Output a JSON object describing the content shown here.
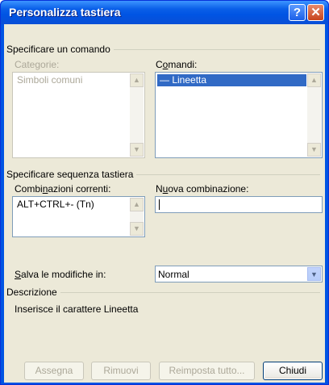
{
  "window": {
    "title": "Personalizza tastiera",
    "help_symbol": "?",
    "close_symbol": "✕"
  },
  "specify_command": {
    "group_label": "Specificare un comando",
    "categories_label": "Categorie:",
    "categories_items": [
      "Simboli comuni"
    ],
    "commands_label_pre": "C",
    "commands_label_ul": "o",
    "commands_label_post": "mandi:",
    "commands_items": [
      "— Lineetta"
    ]
  },
  "keyboard_sequence": {
    "group_label": "Specificare sequenza tastiera",
    "current_label_pre": "Combi",
    "current_label_ul": "n",
    "current_label_post": "azioni correnti:",
    "current_items": [
      "ALT+CTRL+- (Tn)"
    ],
    "new_label_pre": "N",
    "new_label_ul": "u",
    "new_label_post": "ova combinazione:",
    "new_value": ""
  },
  "save_in": {
    "label_pre": "",
    "label_ul": "S",
    "label_post": "alva le modifiche in:",
    "selected": "Normal"
  },
  "description": {
    "group_label": "Descrizione",
    "text": "Inserisce il carattere Lineetta"
  },
  "buttons": {
    "assign": "Assegna",
    "remove": "Rimuovi",
    "reset_all": "Reimposta tutto...",
    "close": "Chiudi"
  },
  "scroll_up_symbol": "▲",
  "scroll_down_symbol": "▼",
  "dropdown_symbol": "▼"
}
